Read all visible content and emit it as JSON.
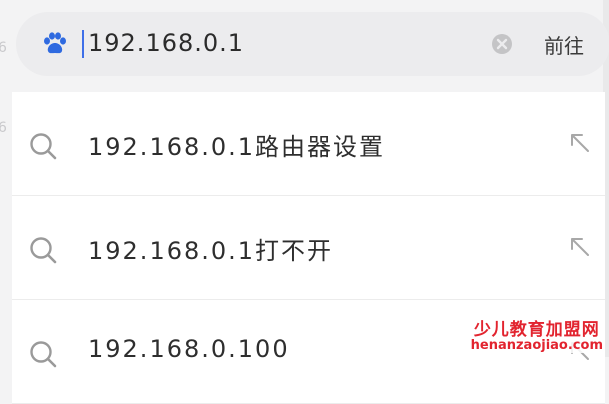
{
  "search": {
    "value": "192.168.0.1",
    "go_label": "前往"
  },
  "suggestions": [
    {
      "text": "192.168.0.1路由器设置"
    },
    {
      "text": "192.168.0.1打不开"
    },
    {
      "text": "192.168.0.100"
    }
  ],
  "watermark": {
    "line1": "少儿教育加盟网",
    "line2": "henanzaojiao.com"
  },
  "colors": {
    "accent": "#3e6fe8",
    "watermark": "#e2242f",
    "search_bar_bg": "#ececee"
  },
  "icons": {
    "search_bar_logo": "baidu-paw-icon",
    "clear": "clear-icon",
    "suggestion_leading": "search-icon",
    "suggestion_trailing": "fill-arrow-icon"
  }
}
